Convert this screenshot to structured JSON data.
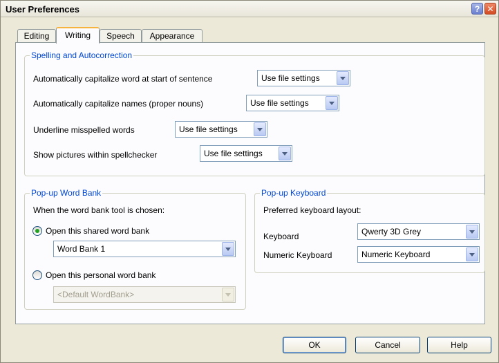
{
  "window": {
    "title": "User Preferences"
  },
  "tabs": [
    {
      "label": "Editing"
    },
    {
      "label": "Writing"
    },
    {
      "label": "Speech"
    },
    {
      "label": "Appearance"
    }
  ],
  "spelling": {
    "legend": "Spelling and Autocorrection",
    "rows": [
      {
        "label": "Automatically capitalize word at start of sentence",
        "value": "Use file settings"
      },
      {
        "label": "Automatically capitalize names (proper nouns)",
        "value": "Use file settings"
      },
      {
        "label": "Underline misspelled words",
        "value": "Use file settings"
      },
      {
        "label": "Show pictures within spellchecker",
        "value": "Use file settings"
      }
    ]
  },
  "word_bank": {
    "legend": "Pop-up Word Bank",
    "prompt": "When the word bank tool is chosen:",
    "shared_label": "Open this shared word bank",
    "shared_value": "Word Bank 1",
    "personal_label": "Open this personal word bank",
    "personal_value": "<Default WordBank>",
    "selected": "shared"
  },
  "keyboard": {
    "legend": "Pop-up Keyboard",
    "prompt": "Preferred keyboard layout:",
    "keyboard_label": "Keyboard",
    "keyboard_value": "Qwerty 3D Grey",
    "numeric_label": "Numeric Keyboard",
    "numeric_value": "Numeric Keyboard"
  },
  "buttons": {
    "ok": "OK",
    "cancel": "Cancel",
    "help": "Help"
  },
  "colors": {
    "accent": "#0046d5",
    "tab_highlight": "#f6b43e",
    "radio_dot": "#21a121"
  }
}
